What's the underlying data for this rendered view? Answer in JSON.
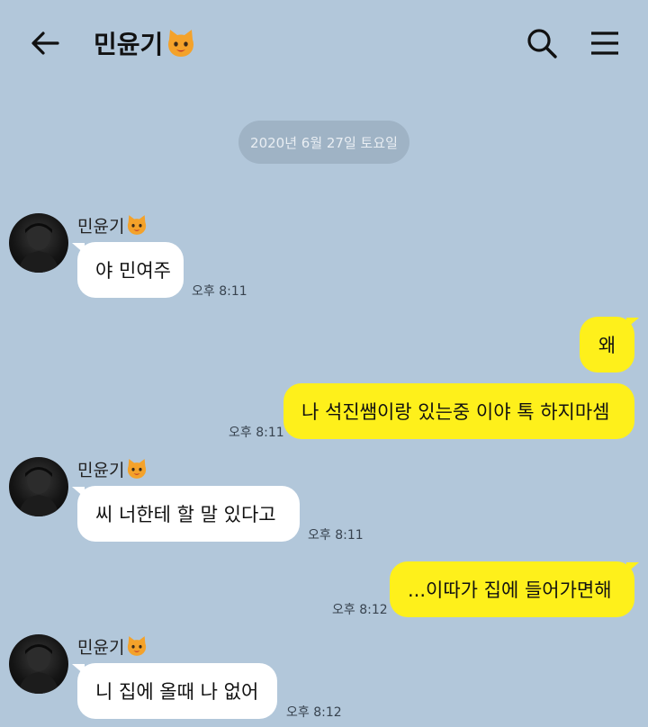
{
  "header": {
    "title": "민윤기",
    "title_icon": "cat-face-icon",
    "back_icon": "back-arrow-icon",
    "search_icon": "search-icon",
    "menu_icon": "menu-icon"
  },
  "date_divider": "2020년 6월 27일 토요일",
  "colors": {
    "background": "#b2c7da",
    "incoming_bubble": "#ffffff",
    "outgoing_bubble": "#fef01b",
    "date_pill": "#9fb3c5"
  },
  "messages": [
    {
      "direction": "in",
      "sender": "민윤기",
      "text": "야 민여주",
      "time": "오후 8:11"
    },
    {
      "direction": "out",
      "text": "왜",
      "time": ""
    },
    {
      "direction": "out",
      "text": "나 석진쌤이랑 있는중 이야 톡 하지마셈",
      "time": "오후 8:11"
    },
    {
      "direction": "in",
      "sender": "민윤기",
      "text": "씨 너한테 할 말 있다고",
      "time": "오후 8:11"
    },
    {
      "direction": "out",
      "text": "...이따가 집에 들어가면해",
      "time": "오후 8:12"
    },
    {
      "direction": "in",
      "sender": "민윤기",
      "text": "니 집에 올때 나 없어",
      "time": "오후 8:12"
    }
  ]
}
